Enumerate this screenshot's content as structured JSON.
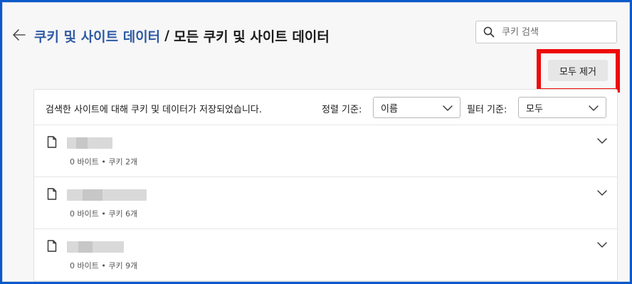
{
  "header": {
    "back_icon": "arrow-left-icon",
    "breadcrumb_parent": "쿠키 및 사이트 데이터",
    "breadcrumb_separator": "/",
    "breadcrumb_current": "모든 쿠키 및 사이트 데이터"
  },
  "search": {
    "icon": "search-icon",
    "placeholder": "쿠키 검색"
  },
  "remove_all_label": "모두 제거",
  "toolbar": {
    "description": "검색한 사이트에 대해 쿠키 및 데이터가 저장되었습니다.",
    "sort_label": "정렬 기준:",
    "sort_value": "이름",
    "filter_label": "필터 기준:",
    "filter_value": "모두"
  },
  "sites": [
    {
      "meta": "0 바이트 • 쿠키 2개"
    },
    {
      "meta": "0 바이트 • 쿠키 6개"
    },
    {
      "meta": "0 바이트 • 쿠키 9개"
    }
  ],
  "colors": {
    "link": "#2e5aa3",
    "highlight": "#ee0a0a",
    "outer_border": "#0a58ca"
  }
}
